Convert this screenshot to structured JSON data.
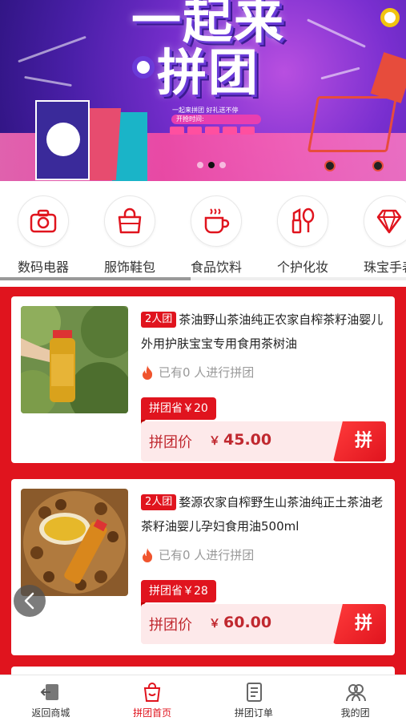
{
  "banner": {
    "title_line1": "一起来",
    "title_line2": "拼团",
    "subtitle": "一起来拼团 好礼送不停",
    "time_label": "开抢时间:",
    "slide_count": 3,
    "active_slide": 2
  },
  "categories": [
    {
      "label": "数码电器",
      "icon": "camera-icon"
    },
    {
      "label": "服饰鞋包",
      "icon": "handbag-icon"
    },
    {
      "label": "食品饮料",
      "icon": "coffee-cup-icon"
    },
    {
      "label": "个护化妆",
      "icon": "cosmetics-icon"
    },
    {
      "label": "珠宝手表",
      "icon": "diamond-icon"
    }
  ],
  "products": [
    {
      "badge": "2人团",
      "name": "茶油野山茶油纯正农家自榨茶籽油婴儿外用护肤宝宝专用食用茶树油",
      "progress": "已有0 人进行拼团",
      "save": "拼团省￥20",
      "price_label": "拼团价",
      "currency": "￥",
      "price": "45.00",
      "action": "拼"
    },
    {
      "badge": "2人团",
      "name": "婺源农家自榨野生山茶油纯正土茶油老茶籽油婴儿孕妇食用油500ml",
      "progress": "已有0 人进行拼团",
      "save": "拼团省￥28",
      "price_label": "拼团价",
      "currency": "￥",
      "price": "60.00",
      "action": "拼"
    }
  ],
  "tabbar": [
    {
      "label": "返回商城",
      "icon": "back-store-icon",
      "active": false
    },
    {
      "label": "拼团首页",
      "icon": "shopping-bag-icon",
      "active": true
    },
    {
      "label": "拼团订单",
      "icon": "order-list-icon",
      "active": false
    },
    {
      "label": "我的团",
      "icon": "my-group-icon",
      "active": false
    }
  ],
  "colors": {
    "accent": "#e0141e",
    "price": "#c0282f",
    "price_bg": "#fde9ea"
  }
}
